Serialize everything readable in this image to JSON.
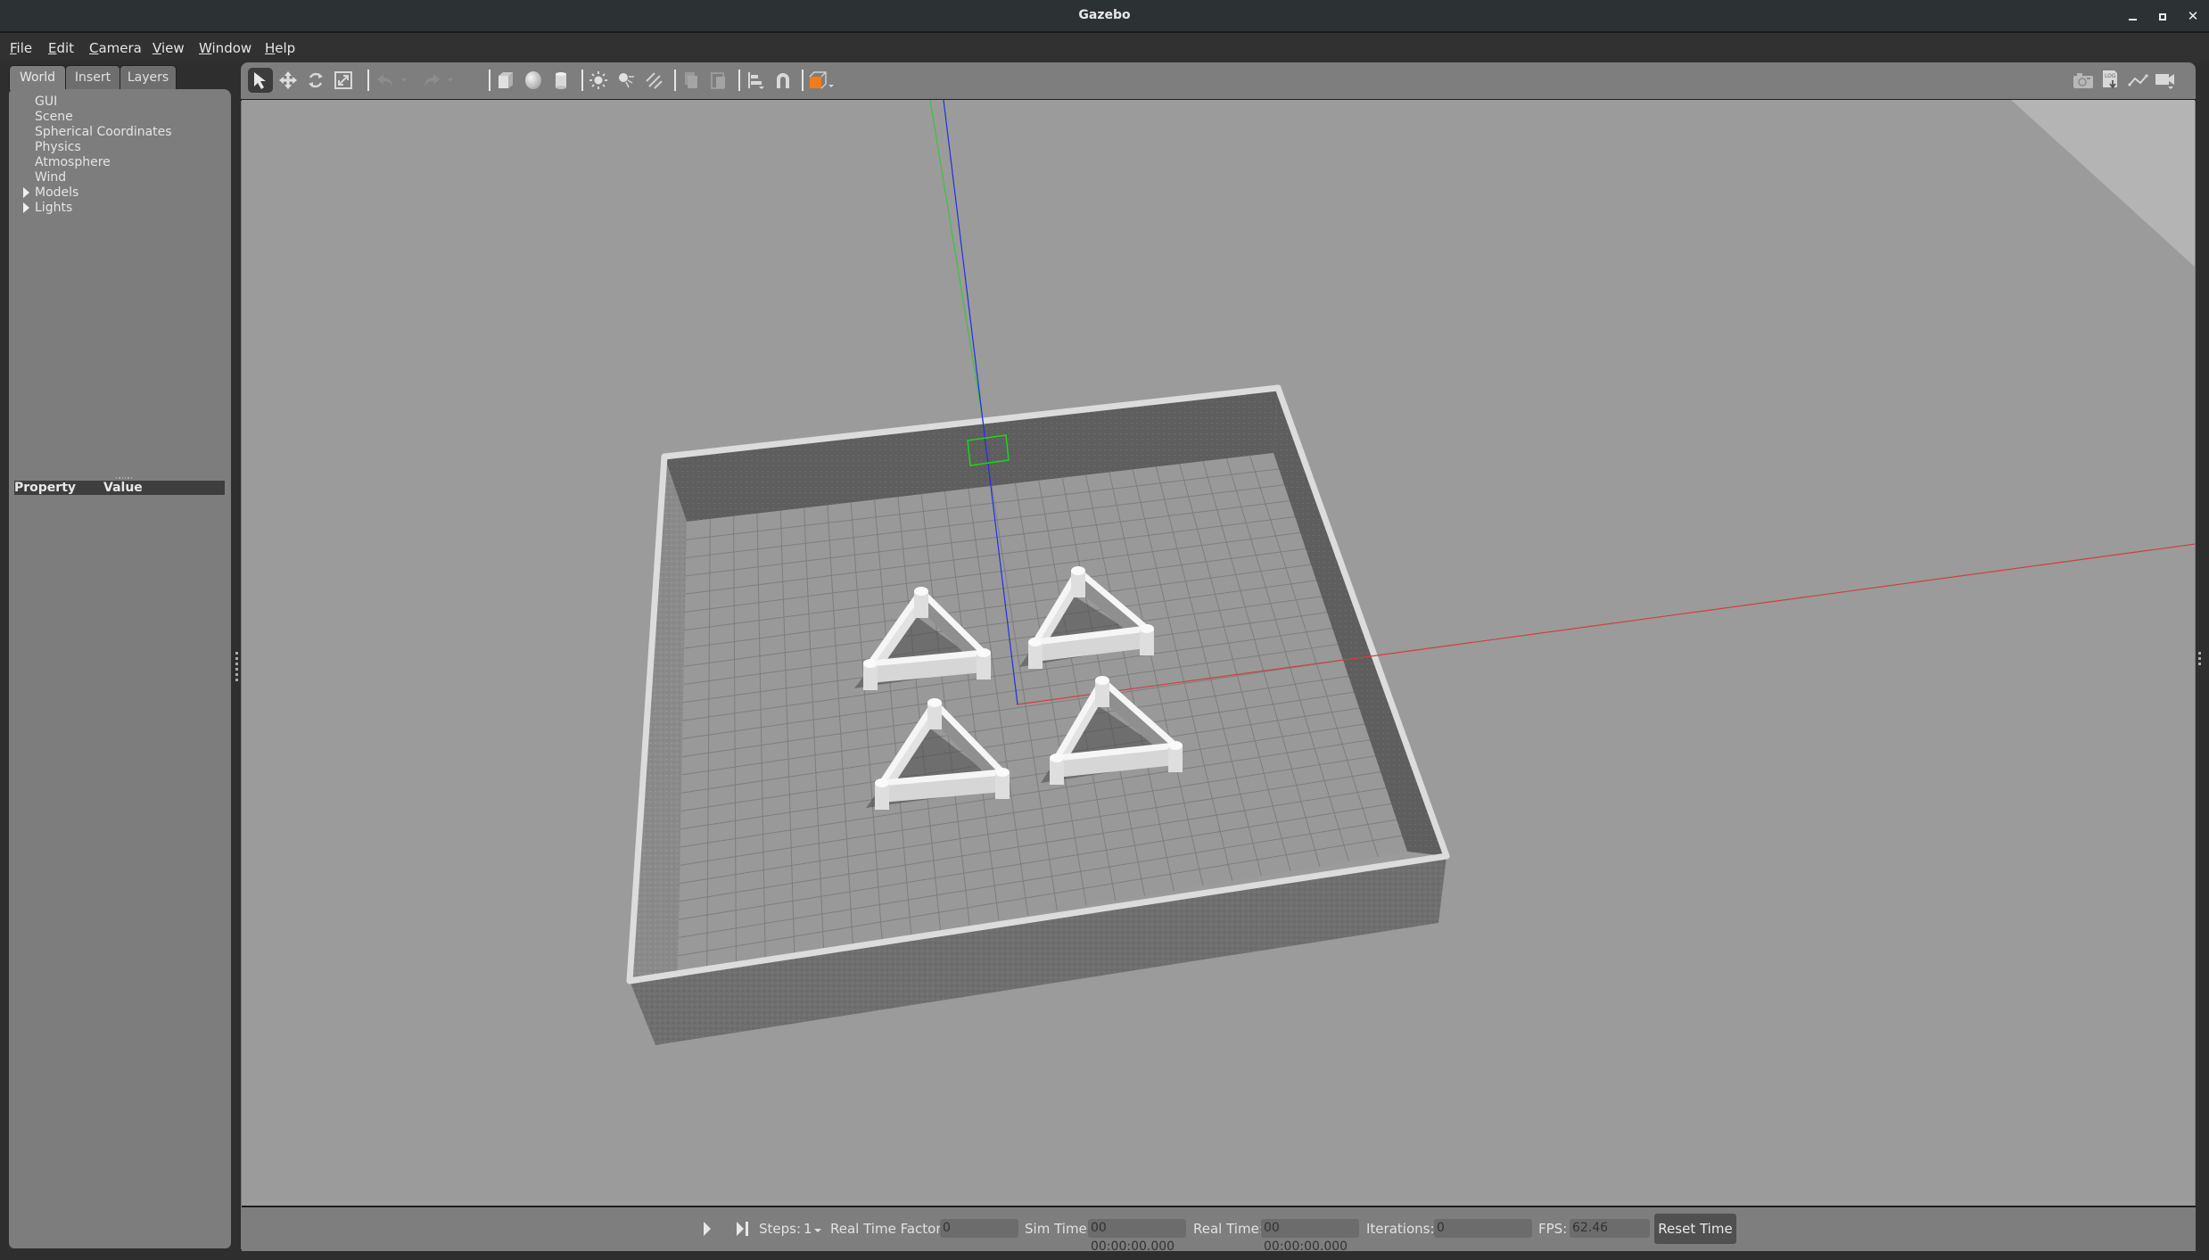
{
  "window": {
    "title": "Gazebo",
    "controls": [
      "minimize",
      "maximize",
      "close"
    ]
  },
  "menu": [
    {
      "label": "File",
      "mnemonic": "F"
    },
    {
      "label": "Edit",
      "mnemonic": "E"
    },
    {
      "label": "Camera",
      "mnemonic": "C"
    },
    {
      "label": "View",
      "mnemonic": "V"
    },
    {
      "label": "Window",
      "mnemonic": "W"
    },
    {
      "label": "Help",
      "mnemonic": "H"
    }
  ],
  "left_panel": {
    "tabs": [
      {
        "label": "World",
        "active": true
      },
      {
        "label": "Insert",
        "active": false
      },
      {
        "label": "Layers",
        "active": false
      }
    ],
    "tree": [
      {
        "label": "GUI",
        "expandable": false
      },
      {
        "label": "Scene",
        "expandable": false
      },
      {
        "label": "Spherical Coordinates",
        "expandable": false
      },
      {
        "label": "Physics",
        "expandable": false
      },
      {
        "label": "Atmosphere",
        "expandable": false
      },
      {
        "label": "Wind",
        "expandable": false
      },
      {
        "label": "Models",
        "expandable": true
      },
      {
        "label": "Lights",
        "expandable": true
      }
    ],
    "property_table": {
      "col_property": "Property",
      "col_value": "Value"
    }
  },
  "toolbar": {
    "left_tools": [
      "select-mode",
      "translate-mode",
      "rotate-mode",
      "scale-mode",
      "undo",
      "undo-history",
      "redo",
      "redo-history",
      "box-shape",
      "sphere-shape",
      "cylinder-shape",
      "point-light",
      "spot-light",
      "directional-light",
      "copy",
      "paste",
      "align",
      "snap",
      "view-angle"
    ],
    "right_tools": [
      "screenshot",
      "log",
      "plot",
      "record-video"
    ],
    "accent_color": "#f07d1a"
  },
  "scene": {
    "description": "3D viewport: walled square arena with grid floor and four triangular obstacles",
    "obstacle_count": 4,
    "axis_colors": {
      "x": "#d04040",
      "y": "#40c040",
      "z": "#2030e0"
    },
    "selection_color": "#20d020"
  },
  "bottom_bar": {
    "steps_label": "Steps:",
    "steps_value": "1",
    "rtf_label": "Real Time Factor:",
    "rtf_value": "0",
    "sim_time_label": "Sim Time:",
    "sim_time_value": "00 00:00:00.000",
    "real_time_label": "Real Time:",
    "real_time_value": "00 00:00:00.000",
    "iterations_label": "Iterations:",
    "iterations_value": "0",
    "fps_label": "FPS:",
    "fps_value": "62.46",
    "reset_label": "Reset Time"
  }
}
